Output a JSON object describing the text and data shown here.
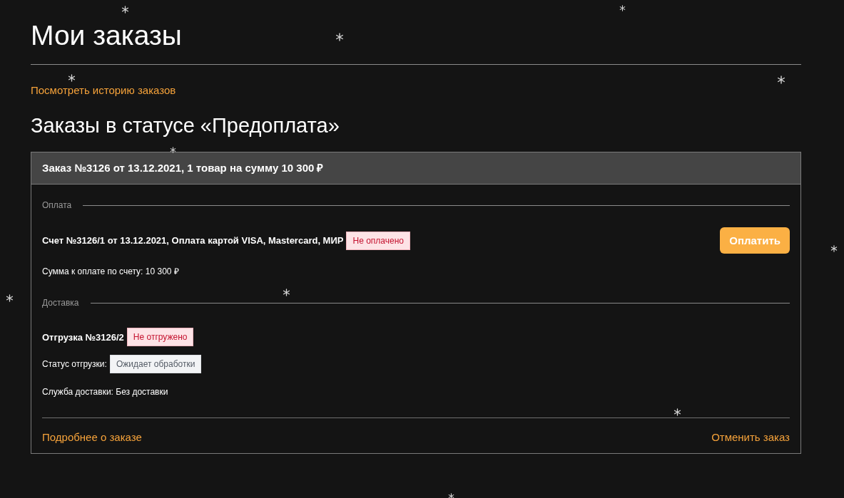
{
  "title": "Мои заказы",
  "history_link": "Посмотреть историю заказов",
  "section_title": "Заказы в статусе «Предоплата»",
  "order": {
    "header": "Заказ №3126 от 13.12.2021, 1 товар на сумму 10 300 ₽",
    "payment": {
      "legend": "Оплата",
      "invoice": "Счет №3126/1 от 13.12.2021, Оплата картой VISA, Mastercard, МИР",
      "badge": {
        "text": "Не оплачено",
        "kind": "danger"
      },
      "pay_button": "Оплатить",
      "amount": "Сумма к оплате по счету: 10 300 ₽"
    },
    "delivery": {
      "legend": "Доставка",
      "shipment": "Отгрузка №3126/2",
      "badge": {
        "text": "Не отгружено",
        "kind": "danger"
      },
      "status_label": "Статус отгрузки:",
      "status_badge": {
        "text": "Ожидает обработки",
        "kind": "neutral"
      },
      "service": "Служба доставки: Без доставки"
    },
    "details_link": "Подробнее о заказе",
    "cancel_link": "Отменить заказ"
  }
}
